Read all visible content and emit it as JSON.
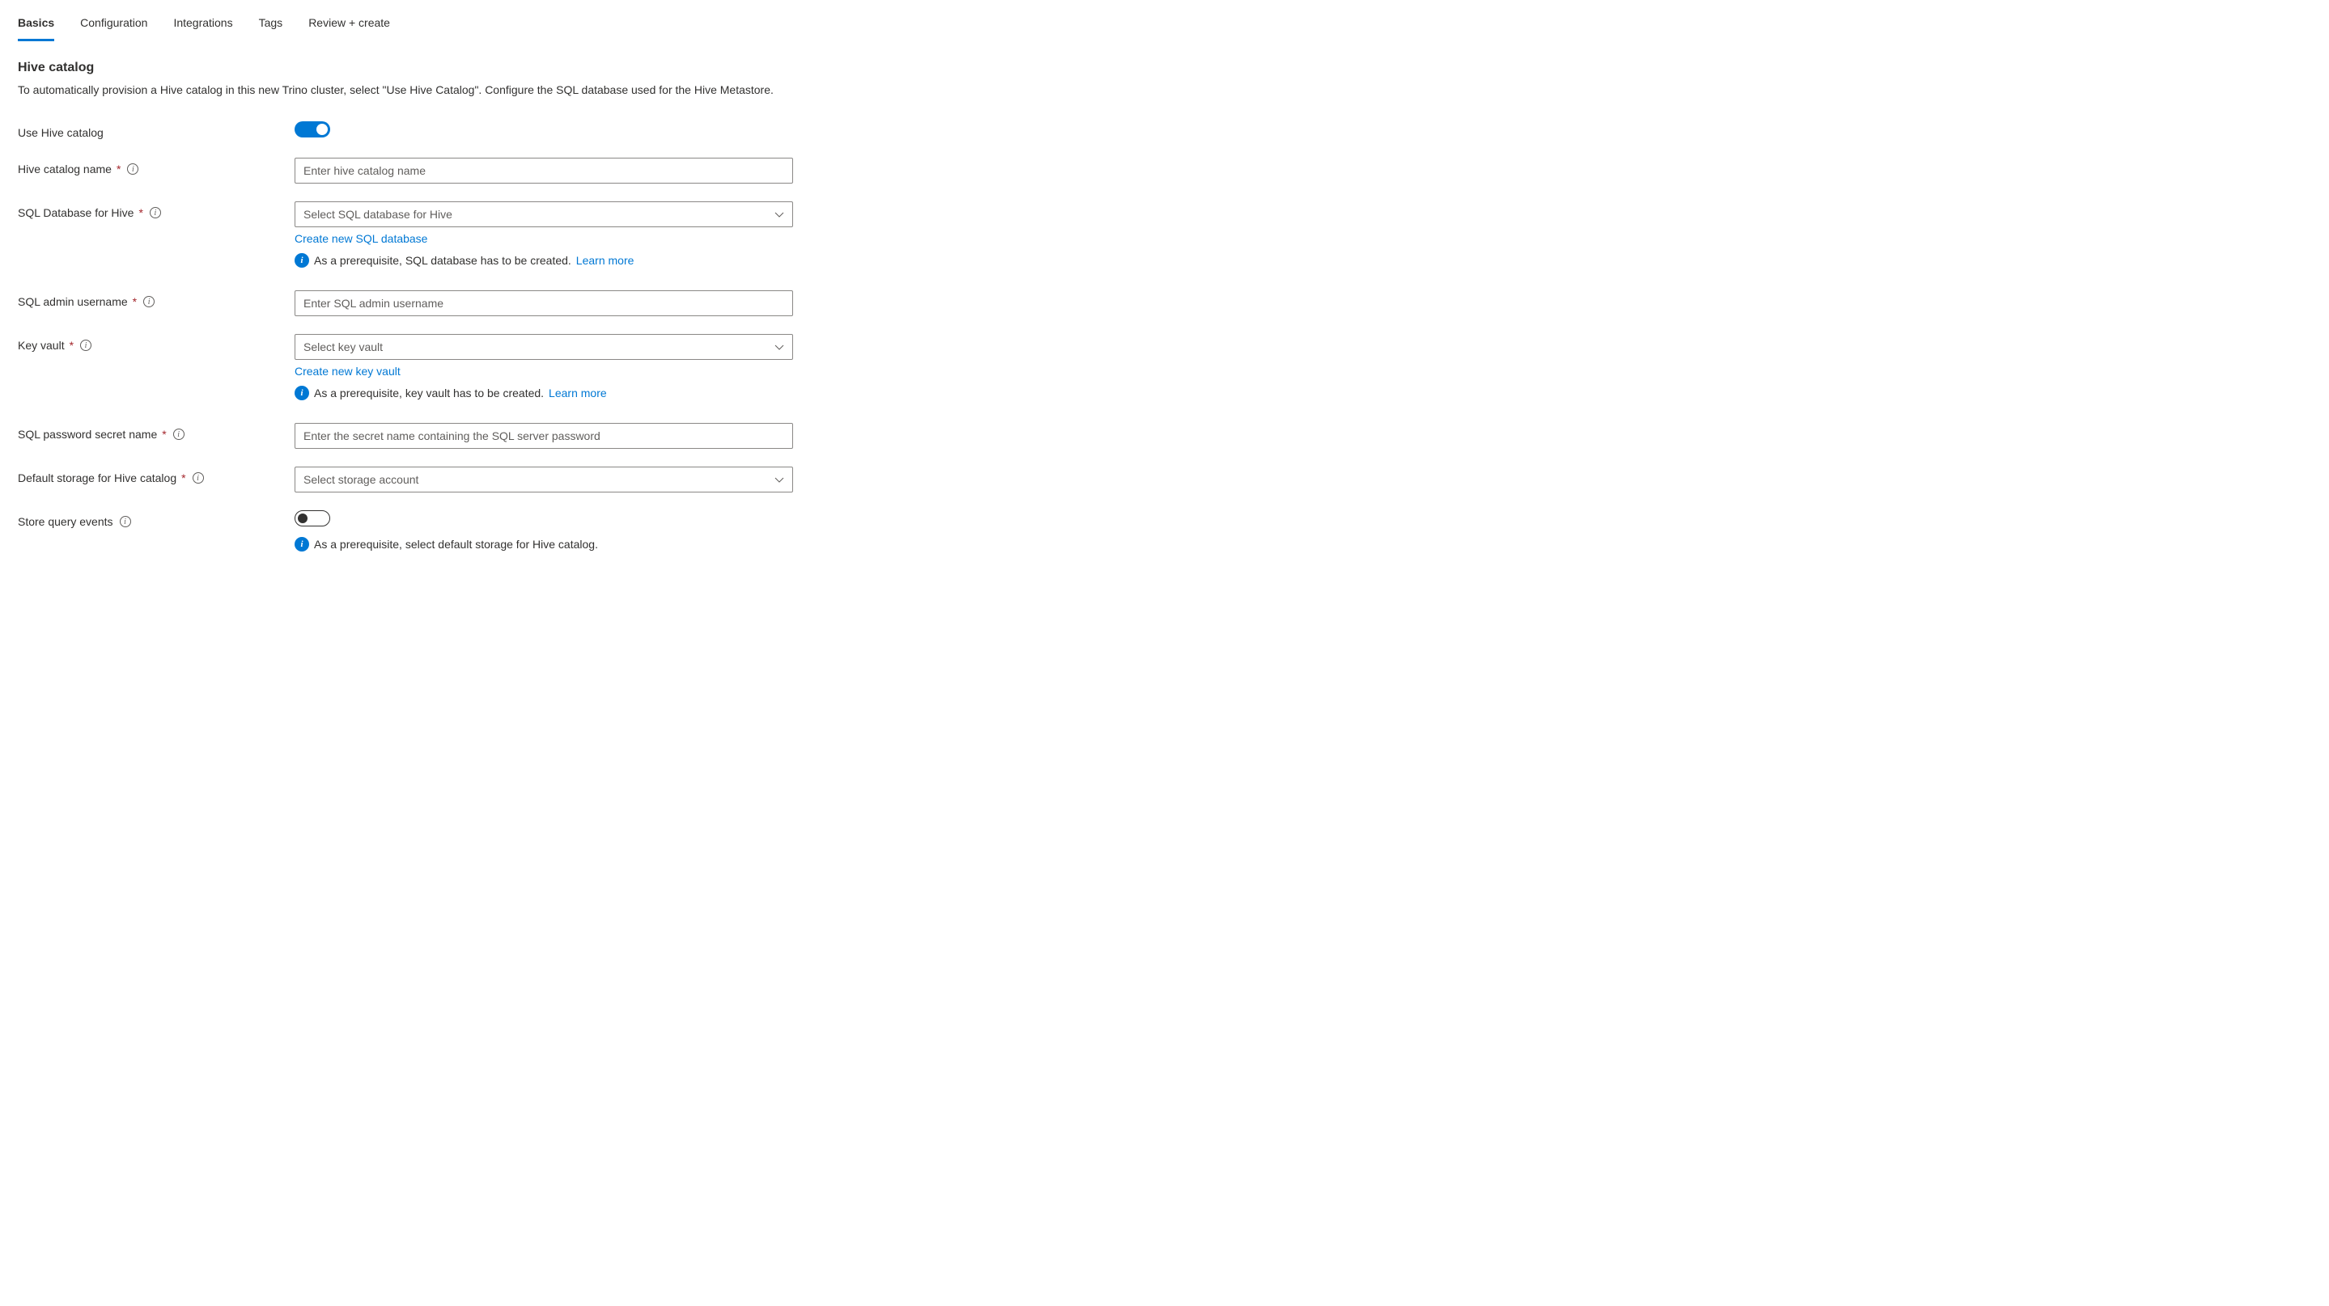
{
  "tabs": {
    "basics": "Basics",
    "configuration": "Configuration",
    "integrations": "Integrations",
    "tags": "Tags",
    "review": "Review + create"
  },
  "section": {
    "title": "Hive catalog",
    "desc": "To automatically provision a Hive catalog in this new Trino cluster, select \"Use Hive Catalog\". Configure the SQL database used for the Hive Metastore."
  },
  "labels": {
    "useHive": "Use Hive catalog",
    "catalogName": "Hive catalog name",
    "sqlDb": "SQL Database for Hive",
    "sqlAdmin": "SQL admin username",
    "keyVault": "Key vault",
    "secretName": "SQL password secret name",
    "defaultStorage": "Default storage for Hive catalog",
    "storeEvents": "Store query events"
  },
  "placeholders": {
    "catalogName": "Enter hive catalog name",
    "sqlDb": "Select SQL database for Hive",
    "sqlAdmin": "Enter SQL admin username",
    "keyVault": "Select key vault",
    "secretName": "Enter the secret name containing the SQL server password",
    "defaultStorage": "Select storage account"
  },
  "links": {
    "createSqlDb": "Create new SQL database",
    "createKeyVault": "Create new key vault",
    "learnMore": "Learn more"
  },
  "notes": {
    "sqlPrereq": "As a prerequisite, SQL database has to be created.",
    "kvPrereq": "As a prerequisite, key vault has to be created.",
    "storagePrereq": "As a prerequisite, select default storage for Hive catalog."
  },
  "toggles": {
    "useHive": true,
    "storeEvents": false
  }
}
